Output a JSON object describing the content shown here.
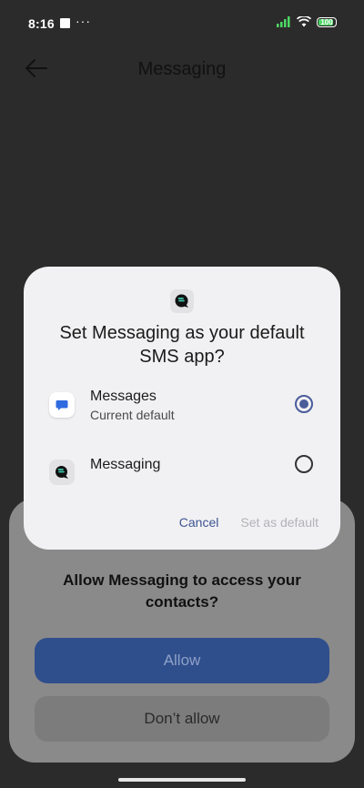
{
  "status_bar": {
    "time": "8:16",
    "dots": "···",
    "battery_text": "100"
  },
  "app_header": {
    "title": "Messaging"
  },
  "dialog": {
    "title": "Set Messaging as your default SMS app?",
    "options": [
      {
        "label": "Messages",
        "sublabel": "Current default",
        "selected": true,
        "icon": "messages-app-icon"
      },
      {
        "label": "Messaging",
        "sublabel": "",
        "selected": false,
        "icon": "messaging-app-icon"
      }
    ],
    "cancel_label": "Cancel",
    "set_default_label": "Set as default"
  },
  "permission_sheet": {
    "title": "Allow Messaging to access your contacts?",
    "allow_label": "Allow",
    "deny_label": "Don’t allow"
  },
  "colors": {
    "accent": "#4a5c9a",
    "allow_button": "#2f4e8c",
    "dialog_bg": "#f1f1f3"
  }
}
